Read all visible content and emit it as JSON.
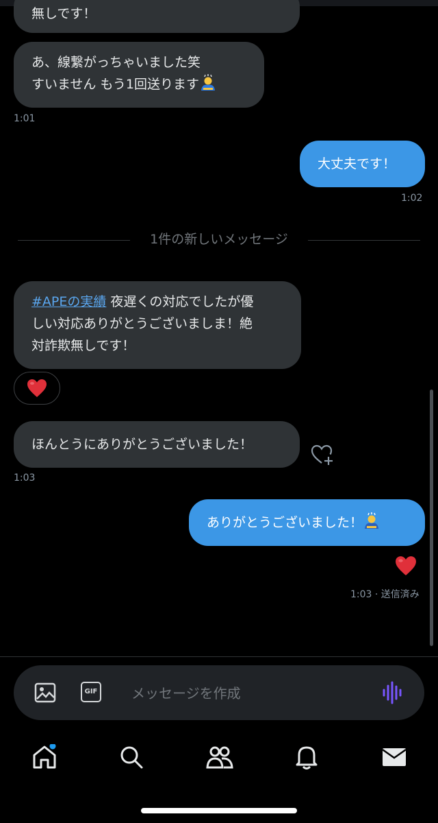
{
  "messages": {
    "m0_text": "無しです！",
    "m1_line1": "あ、線繋がっちゃいました笑",
    "m1_line2": "すいません もう1回送ります",
    "m1_time": "1:01",
    "m2_text": "大丈夫です！",
    "m2_time": "1:02",
    "divider": "1件の新しいメッセージ",
    "m3_hashtag": "#APEの実績",
    "m3_line1_rest": " 夜遅くの対応でしたが優",
    "m3_line2": "しい対応ありがとうございましま！絶",
    "m3_line3": "対詐欺無しです！",
    "m3_reaction": "❤️",
    "m4_text": "ほんとうにありがとうございました！",
    "m4_time": "1:03",
    "m5_text": "ありがとうございました！",
    "m5_reaction": "❤️",
    "m5_status": "1:03 · 送信済み"
  },
  "composer": {
    "placeholder": "メッセージを作成",
    "gif_label": "GIF"
  },
  "icons": {
    "image": "image-icon",
    "gif": "gif-icon",
    "voice": "voice-wave-icon",
    "home": "home-icon",
    "search": "search-icon",
    "communities": "people-icon",
    "notifications": "bell-icon",
    "messages": "mail-icon",
    "add_reaction": "heart-plus-icon"
  },
  "colors": {
    "accent": "#1d9bf0",
    "bubble_in": "#2f3336",
    "voice": "#7856ff",
    "notification_dot": "#1d9bf0"
  }
}
